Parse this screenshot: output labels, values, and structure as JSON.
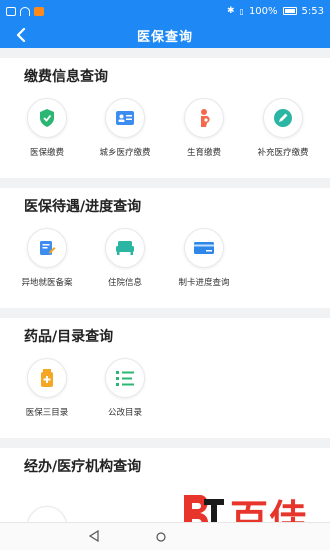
{
  "status": {
    "battery": "100%",
    "time": "5:53"
  },
  "nav": {
    "title": "医保查询"
  },
  "sections": [
    {
      "title": "缴费信息查询",
      "items": [
        {
          "label": "医保缴费",
          "icon": "shield-icon",
          "color": "#2bb673"
        },
        {
          "label": "城乡医疗缴费",
          "icon": "id-card-icon",
          "color": "#3d8cf0"
        },
        {
          "label": "生育缴费",
          "icon": "pregnant-woman-icon",
          "color": "#f26a4b"
        },
        {
          "label": "补充医疗缴费",
          "icon": "pencil-icon",
          "color": "#2bb6a3"
        }
      ]
    },
    {
      "title": "医保待遇/进度查询",
      "items": [
        {
          "label": "异地就医备案",
          "icon": "edit-document-icon",
          "color": "#3d8cf0"
        },
        {
          "label": "住院信息",
          "icon": "bed-icon",
          "color": "#2bb6a3"
        },
        {
          "label": "制卡进度查询",
          "icon": "card-icon",
          "color": "#2e86e6"
        }
      ]
    },
    {
      "title": "药品/目录查询",
      "items": [
        {
          "label": "医保三目录",
          "icon": "medicine-bottle-icon",
          "color": "#f5a623"
        },
        {
          "label": "公改目录",
          "icon": "list-icon",
          "color": "#2bb673"
        }
      ]
    },
    {
      "title": "经办/医疗机构查询",
      "items": []
    }
  ],
  "watermark": {
    "text": "百佳"
  }
}
